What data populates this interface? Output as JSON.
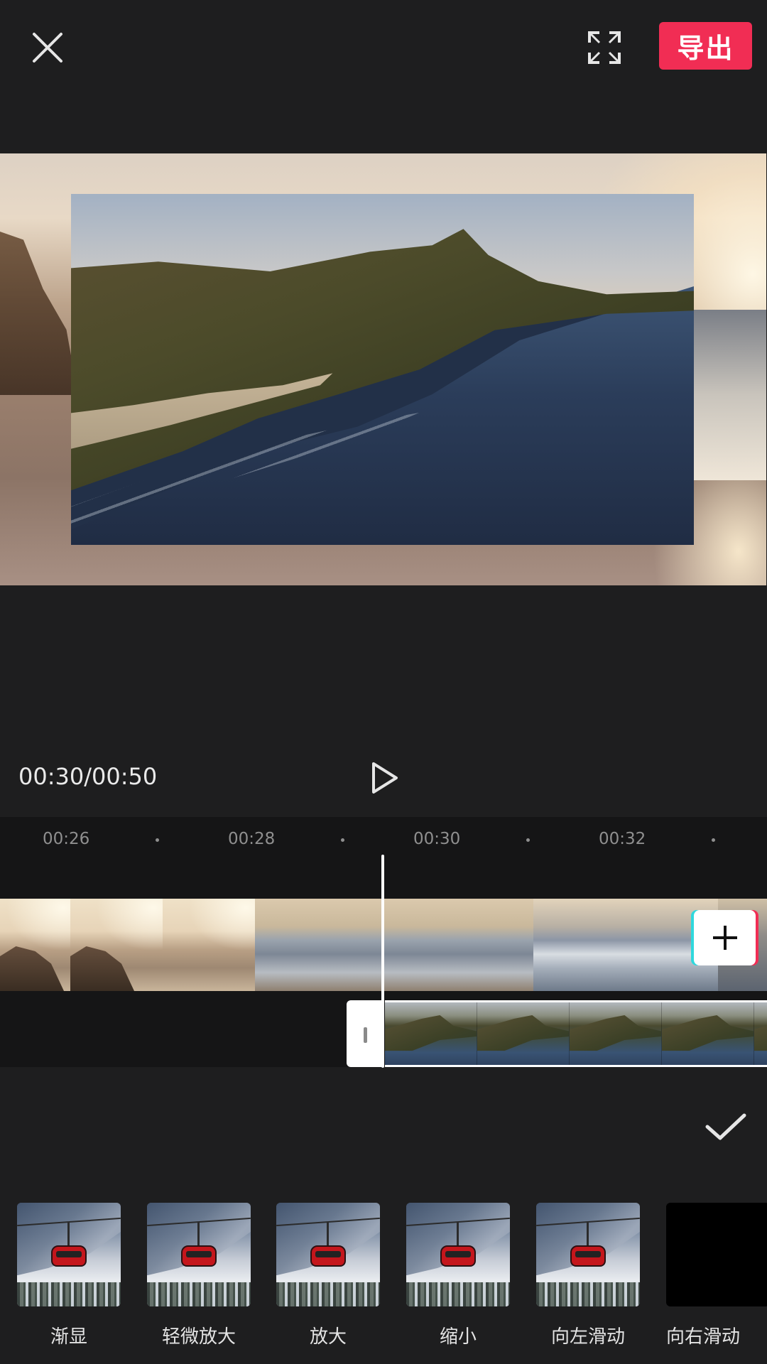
{
  "header": {
    "close_icon": "close-icon",
    "fullscreen_icon": "fullscreen-icon",
    "export_label": "导出"
  },
  "playback": {
    "current_time": "00:30",
    "total_time": "00:50",
    "time_display": "00:30/00:50",
    "play_icon": "play-icon"
  },
  "timeline": {
    "ticks": [
      "00:26",
      "00:28",
      "00:30",
      "00:32"
    ],
    "add_icon": "plus-icon"
  },
  "confirm_icon": "check-icon",
  "effects": [
    {
      "label": "渐显"
    },
    {
      "label": "轻微放大"
    },
    {
      "label": "放大"
    },
    {
      "label": "缩小"
    },
    {
      "label": "向左滑动"
    },
    {
      "label": "向右滑动"
    }
  ],
  "colors": {
    "accent": "#f12d54",
    "background": "#1e1e1f",
    "track_background": "#151516"
  }
}
